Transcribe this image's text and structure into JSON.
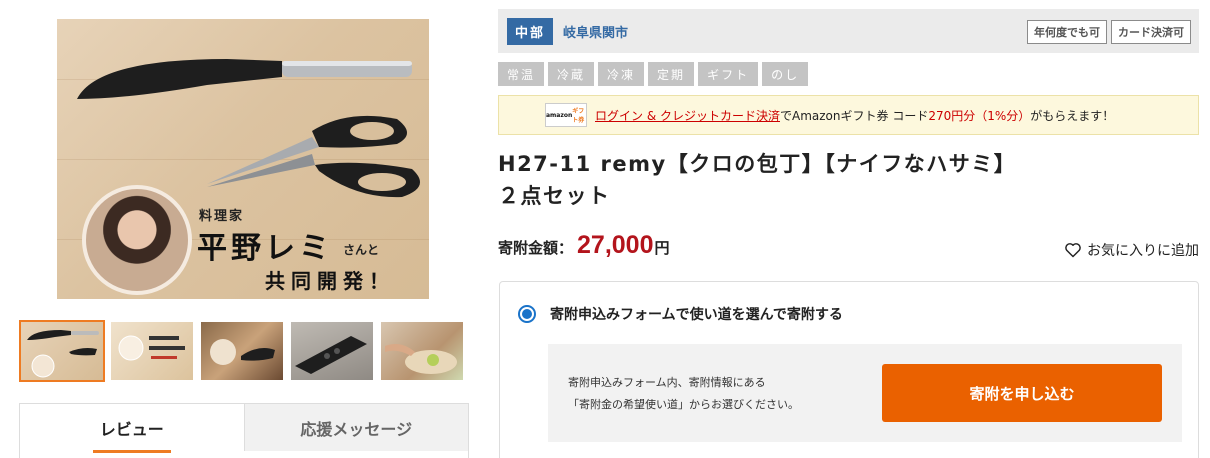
{
  "gallery": {
    "main_caption": {
      "small": "料理家",
      "name": "平野レミ",
      "san": "さんと",
      "dev": "共同開発！"
    },
    "thumbnails": [
      "thumb-1",
      "thumb-2",
      "thumb-3",
      "thumb-4",
      "thumb-5"
    ]
  },
  "tabs": [
    {
      "label": "レビュー"
    },
    {
      "label": "応援メッセージ"
    }
  ],
  "region": {
    "tag": "中部",
    "city": "岐阜県関市",
    "badges": [
      "年何度でも可",
      "カード決済可"
    ]
  },
  "chips": [
    "常温",
    "冷蔵",
    "冷凍",
    "定期",
    "ギフト",
    "のし"
  ],
  "amazon": {
    "logo_text_main": "amazon",
    "logo_text_sub": "ギフト券",
    "link_text": "ログイン & クレジットカード決済",
    "text_1": "でAmazonギフト券 コード",
    "amount": "270円分（1%分）",
    "text_2": "がもらえます！"
  },
  "product": {
    "title": "H27-11 remy【クロの包丁】【ナイフなハサミ】 ２点セット"
  },
  "price": {
    "label": "寄附金額：",
    "value": "27,000",
    "unit": "円"
  },
  "favorite": {
    "label": "お気に入りに追加"
  },
  "form": {
    "radio_label": "寄附申込みフォームで使い道を選んで寄附する",
    "panel_line_1": "寄附申込みフォーム内、寄附情報にある",
    "panel_line_2": "「寄附金の希望使い道」からお選びください。",
    "apply_button": "寄附を申し込む"
  },
  "colors": {
    "accent_orange": "#ea6100",
    "region_blue": "#346aa4",
    "price_red": "#b3141c"
  }
}
